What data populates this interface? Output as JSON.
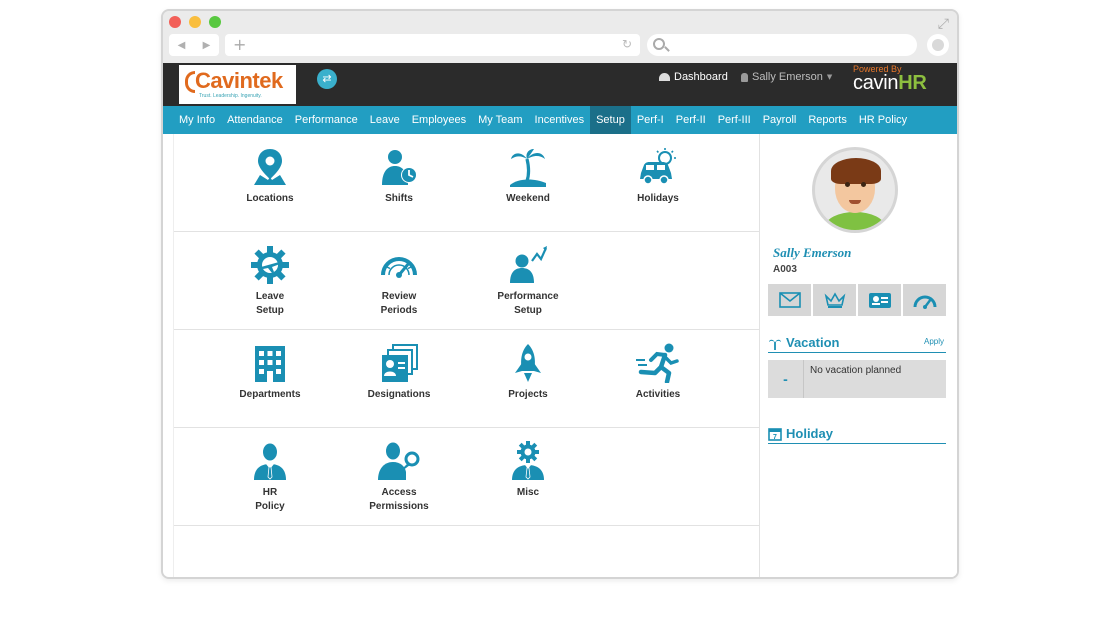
{
  "app": {
    "brand": "Cavintek",
    "brand_tagline": "Trust. Leadership. Ingenuity.",
    "dashboard_label": "Dashboard",
    "user_name": "Sally Emerson",
    "powered_by": "Powered By",
    "product_name": "cavin",
    "product_suffix": "HR"
  },
  "nav": {
    "items": [
      "My Info",
      "Attendance",
      "Performance",
      "Leave",
      "Employees",
      "My Team",
      "Incentives",
      "Setup",
      "Perf-I",
      "Perf-II",
      "Perf-III",
      "Payroll",
      "Reports",
      "HR Policy"
    ],
    "active": "Setup"
  },
  "setup": {
    "rows": [
      [
        {
          "label": "Locations",
          "icon": "location-pin-icon"
        },
        {
          "label": "Shifts",
          "icon": "person-clock-icon"
        },
        {
          "label": "Weekend",
          "icon": "palm-tree-icon"
        },
        {
          "label": "Holidays",
          "icon": "car-sun-icon"
        }
      ],
      [
        {
          "label": "Leave Setup",
          "icon": "gear-plane-icon"
        },
        {
          "label": "Review Periods",
          "icon": "gauge-icon"
        },
        {
          "label": "Performance Setup",
          "icon": "person-chart-icon"
        }
      ],
      [
        {
          "label": "Departments",
          "icon": "building-icon"
        },
        {
          "label": "Designations",
          "icon": "id-cards-icon"
        },
        {
          "label": "Projects",
          "icon": "rocket-icon"
        },
        {
          "label": "Activities",
          "icon": "runner-icon"
        }
      ],
      [
        {
          "label": "HR Policy",
          "icon": "businessman-icon"
        },
        {
          "label": "Access Permissions",
          "icon": "person-key-icon"
        },
        {
          "label": "Misc",
          "icon": "person-gear-icon"
        }
      ]
    ]
  },
  "profile": {
    "name": "Sally Emerson",
    "code": "A003",
    "quick_actions": [
      "mail-icon",
      "crown-icon",
      "id-card-icon",
      "speedometer-icon"
    ]
  },
  "vacation": {
    "title": "Vacation",
    "apply": "Apply",
    "dash": "-",
    "message": "No vacation planned"
  },
  "holiday": {
    "title": "Holiday"
  },
  "colors": {
    "accent": "#229ec2",
    "icon": "#1a8fb3",
    "header": "#2b2b2b",
    "active_tab": "#1b6f89"
  }
}
